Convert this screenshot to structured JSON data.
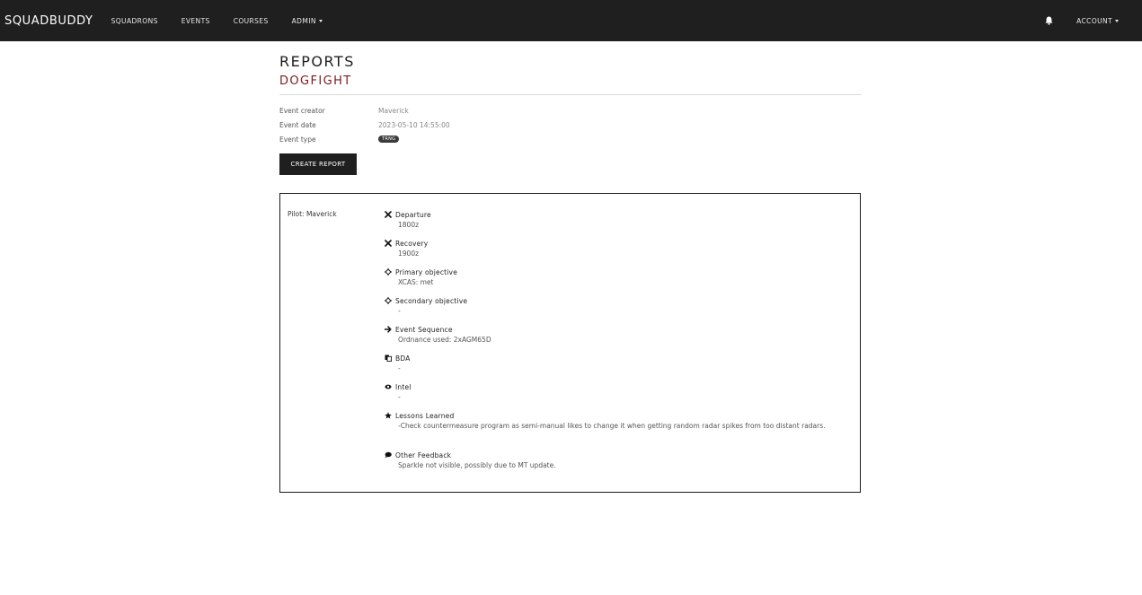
{
  "nav": {
    "brand": "SQUADBUDDY",
    "links": [
      "SQUADRONS",
      "EVENTS",
      "COURSES"
    ],
    "admin": "ADMIN",
    "account": "ACCOUNT"
  },
  "page": {
    "title": "REPORTS",
    "subtitle": "DOGFIGHT"
  },
  "meta": {
    "creator_label": "Event creator",
    "creator_value": "Maverick",
    "date_label": "Event date",
    "date_value": "2023-05-10 14:55:00",
    "type_label": "Event type",
    "type_value": "TRNG"
  },
  "create_button": "CREATE REPORT",
  "report": {
    "pilot": "Pilot: Maverick",
    "fields": [
      {
        "label": "Departure",
        "value": "1800z",
        "icon": "plane-icon"
      },
      {
        "label": "Recovery",
        "value": "1900z",
        "icon": "plane-landing-icon"
      },
      {
        "label": "Primary objective",
        "value": "XCAS: met",
        "icon": "crosshairs-icon"
      },
      {
        "label": "Secondary objective",
        "value": "-",
        "icon": "crosshairs-icon"
      },
      {
        "label": "Event Sequence",
        "value": "Ordnance used: 2xAGM65D",
        "icon": "arrow-right-icon"
      },
      {
        "label": "BDA",
        "value": "-",
        "icon": "copy-icon"
      },
      {
        "label": "Intel",
        "value": "-",
        "icon": "eye-icon"
      },
      {
        "label": "Lessons Learned",
        "value": "-Check countermeasure program as semi-manual likes to change it when getting random radar spikes from too distant radars.",
        "icon": "star-icon"
      },
      {
        "label": "Other Feedback",
        "value": "Sparkle not visible, possibly due to MT update.",
        "icon": "comment-icon"
      }
    ]
  }
}
